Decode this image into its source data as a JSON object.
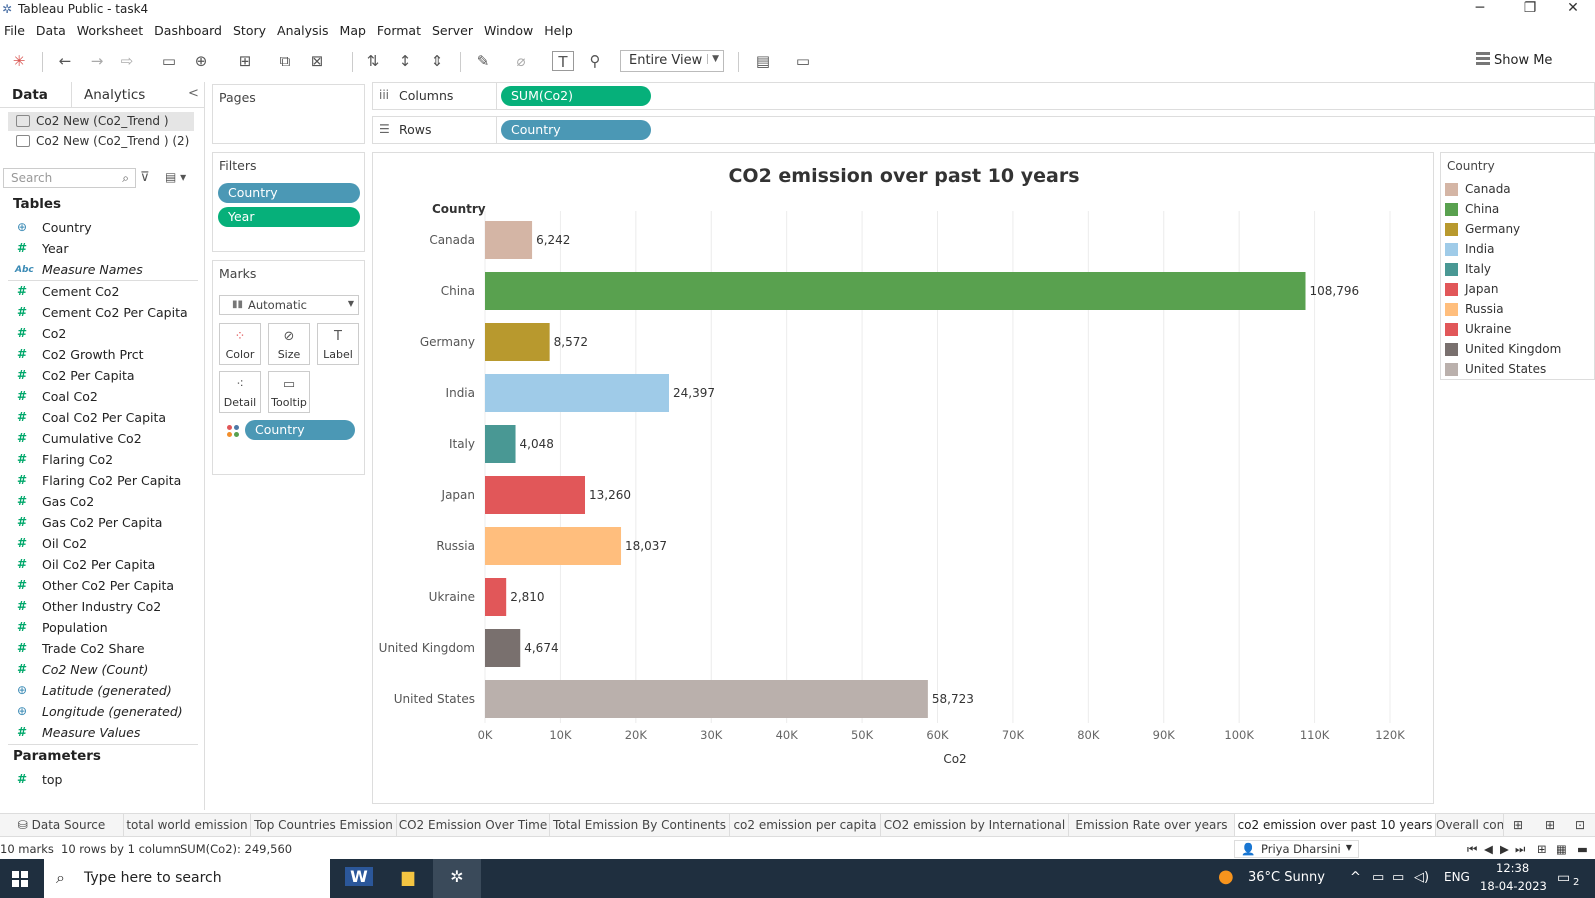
{
  "window": {
    "title": "Tableau Public - task4"
  },
  "menu": [
    "File",
    "Data",
    "Worksheet",
    "Dashboard",
    "Story",
    "Analysis",
    "Map",
    "Format",
    "Server",
    "Window",
    "Help"
  ],
  "toolbar": {
    "view_select": "Entire View",
    "show_me": "Show Me"
  },
  "datapane": {
    "tab_data": "Data",
    "tab_analytics": "Analytics",
    "sources": [
      "Co2 New (Co2_Trend )",
      "Co2 New (Co2_Trend ) (2)"
    ],
    "search_placeholder": "Search",
    "tables_heading": "Tables",
    "dimensions": [
      "Country",
      "Year"
    ],
    "measure_names": "Measure Names",
    "measures": [
      "Cement Co2",
      "Cement Co2 Per Capita",
      "Co2",
      "Co2 Growth Prct",
      "Co2 Per Capita",
      "Coal Co2",
      "Coal Co2 Per Capita",
      "Cumulative Co2",
      "Flaring Co2",
      "Flaring Co2 Per Capita",
      "Gas Co2",
      "Gas Co2 Per Capita",
      "Oil Co2",
      "Oil Co2 Per Capita",
      "Other Co2 Per Capita",
      "Other Industry Co2",
      "Population",
      "Trade Co2 Share"
    ],
    "generated": [
      "Co2 New (Count)",
      "Latitude (generated)",
      "Longitude (generated)",
      "Measure Values"
    ],
    "parameters_heading": "Parameters",
    "parameters": [
      "top"
    ]
  },
  "cards": {
    "pages": "Pages",
    "filters": "Filters",
    "filter_pills": [
      "Country",
      "Year"
    ],
    "marks": "Marks",
    "mark_type": "Automatic",
    "mark_buttons": [
      "Color",
      "Size",
      "Label",
      "Detail",
      "Tooltip"
    ],
    "mark_pill": "Country"
  },
  "shelves": {
    "columns_label": "Columns",
    "columns_pill": "SUM(Co2)",
    "rows_label": "Rows",
    "rows_pill": "Country"
  },
  "chart_data": {
    "type": "bar",
    "orientation": "horizontal",
    "title": "CO2 emission over past 10 years",
    "row_header": "Country",
    "xlabel": "Co2",
    "categories": [
      "Canada",
      "China",
      "Germany",
      "India",
      "Italy",
      "Japan",
      "Russia",
      "Ukraine",
      "United Kingdom",
      "United States"
    ],
    "values": [
      6242,
      108796,
      8572,
      24397,
      4048,
      13260,
      18037,
      2810,
      4674,
      58723
    ],
    "value_labels": [
      "6,242",
      "108,796",
      "8,572",
      "24,397",
      "4,048",
      "13,260",
      "18,037",
      "2,810",
      "4,674",
      "58,723"
    ],
    "colors": [
      "#d4b5a5",
      "#59a14f",
      "#b8992e",
      "#9fcbe8",
      "#499894",
      "#e15759",
      "#ffbe7d",
      "#e15759",
      "#79706e",
      "#bab0ac"
    ],
    "xlim": [
      0,
      120000
    ],
    "xticks": [
      0,
      10000,
      20000,
      30000,
      40000,
      50000,
      60000,
      70000,
      80000,
      90000,
      100000,
      110000,
      120000
    ],
    "xtick_labels": [
      "0K",
      "10K",
      "20K",
      "30K",
      "40K",
      "50K",
      "60K",
      "70K",
      "80K",
      "90K",
      "100K",
      "110K",
      "120K"
    ],
    "grid": true,
    "legend_title": "Country",
    "legend": "right"
  },
  "sheet_tabs": {
    "data_source": "Data Source",
    "sheets": [
      "total world emission",
      "Top Countries Emission",
      "CO2 Emission Over Time",
      "Total Emission By Continents",
      "co2 emission per capita",
      "CO2 emission by International",
      "Emission Rate over years",
      "co2 emission over past 10 years",
      "Overall cont"
    ],
    "active": "co2 emission over past 10 years"
  },
  "status": {
    "marks": "10 marks",
    "rows": "10 rows by 1 column",
    "sum": "SUM(Co2): 249,560",
    "user": "Priya Dharsini"
  },
  "taskbar": {
    "search": "Type here to search",
    "weather": "36°C  Sunny",
    "lang": "ENG",
    "time": "12:38",
    "date": "18-04-2023",
    "notifications": "2"
  }
}
